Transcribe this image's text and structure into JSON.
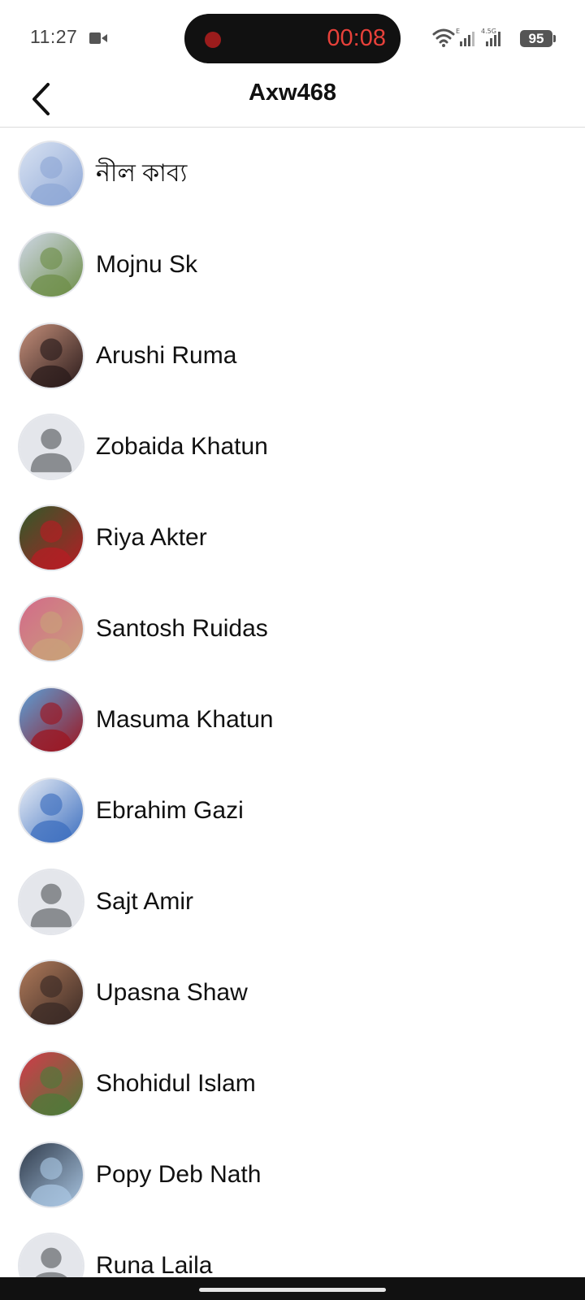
{
  "status_bar": {
    "time": "11:27",
    "recording_timer": "00:08",
    "battery": "95",
    "network_label_1": "E",
    "network_label_2": "4.5G",
    "icons": [
      "video-camera-icon",
      "recording-dot-icon",
      "wifi-icon",
      "signal-icon",
      "signal-icon",
      "battery-icon"
    ]
  },
  "header": {
    "title": "Axw468",
    "back_icon": "chevron-left-icon"
  },
  "contacts": [
    {
      "name": "নীল কাব্য",
      "avatar": "photo",
      "avatar_colors": [
        "#8fa8d6",
        "#d8e2f2"
      ]
    },
    {
      "name": "Mojnu Sk",
      "avatar": "photo",
      "avatar_colors": [
        "#6f8f4a",
        "#cfd7e6"
      ]
    },
    {
      "name": "Arushi Ruma",
      "avatar": "photo",
      "avatar_colors": [
        "#2a1b1b",
        "#c48f7a"
      ]
    },
    {
      "name": "Zobaida Khatun",
      "avatar": "default",
      "avatar_colors": [
        "#e4e6eb",
        "#8a8d91"
      ]
    },
    {
      "name": "Riya Akter",
      "avatar": "photo",
      "avatar_colors": [
        "#b51d24",
        "#2f5a2a"
      ]
    },
    {
      "name": "Santosh Ruidas",
      "avatar": "photo",
      "avatar_colors": [
        "#c9a07a",
        "#d36a8a"
      ]
    },
    {
      "name": "Masuma Khatun",
      "avatar": "photo",
      "avatar_colors": [
        "#9c1620",
        "#5aa0d8"
      ]
    },
    {
      "name": "Ebrahim Gazi",
      "avatar": "photo",
      "avatar_colors": [
        "#3d6fbf",
        "#e9eef6"
      ]
    },
    {
      "name": "Sajt Amir",
      "avatar": "default",
      "avatar_colors": [
        "#e4e6eb",
        "#8a8d91"
      ]
    },
    {
      "name": "Upasna Shaw",
      "avatar": "photo",
      "avatar_colors": [
        "#3a2a25",
        "#b07a5a"
      ]
    },
    {
      "name": "Shohidul Islam",
      "avatar": "photo",
      "avatar_colors": [
        "#4f7a3a",
        "#d33a4a"
      ]
    },
    {
      "name": "Popy Deb Nath",
      "avatar": "photo",
      "avatar_colors": [
        "#a8c4e0",
        "#2f3a4a"
      ]
    },
    {
      "name": "Runa Laila",
      "avatar": "default",
      "avatar_colors": [
        "#e4e6eb",
        "#8a8d91"
      ]
    }
  ]
}
